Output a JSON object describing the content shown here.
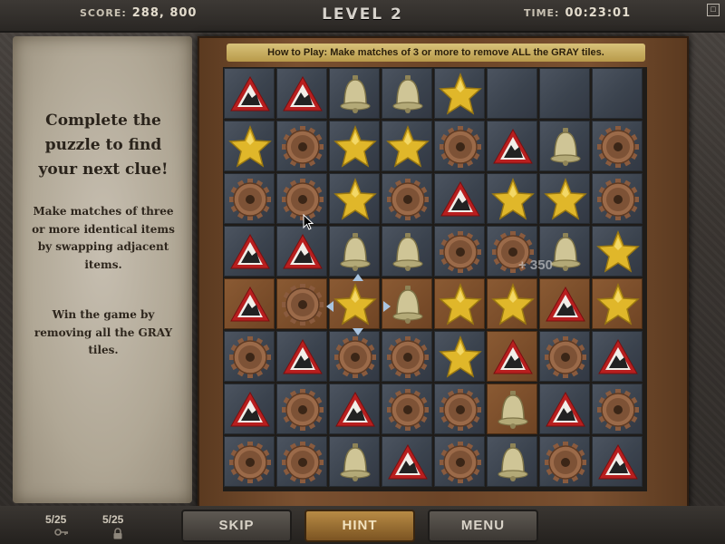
{
  "header": {
    "score_label": "SCORE:",
    "score_value": "288, 800",
    "level": "LEVEL 2",
    "time_label": "TIME:",
    "time_value": "00:23:01"
  },
  "instructions": {
    "title": "Complete the puzzle to find your next clue!",
    "text1": "Make matches of three or more identical items by swapping adjacent items.",
    "text2": "Win the game by removing all the GRAY tiles."
  },
  "howto": "How to Play: Make matches of 3 or more to remove ALL the GRAY tiles.",
  "score_popup": "+ 350",
  "board": {
    "rows": [
      [
        "warning",
        "warning",
        "bell",
        "bell",
        "star",
        "empty",
        "empty",
        "empty"
      ],
      [
        "star",
        "gear",
        "star",
        "star",
        "gear",
        "warning",
        "bell",
        "gear"
      ],
      [
        "gear",
        "gear",
        "star",
        "gear",
        "warning",
        "star",
        "star",
        "gear"
      ],
      [
        "warning",
        "warning",
        "bell",
        "bell",
        "gear",
        "gear",
        "bell",
        "star"
      ],
      [
        "warning",
        "gear",
        "star",
        "bell",
        "star",
        "star",
        "warning",
        "star"
      ],
      [
        "gear",
        "warning",
        "gear",
        "gear",
        "star",
        "warning",
        "gear",
        "warning"
      ],
      [
        "warning",
        "gear",
        "warning",
        "gear",
        "gear",
        "bell",
        "warning",
        "gear"
      ],
      [
        "gear",
        "gear",
        "bell",
        "warning",
        "gear",
        "bell",
        "gear",
        "warning"
      ]
    ],
    "tile_state": [
      [
        "gray",
        "gray",
        "gray",
        "gray",
        "gray",
        "gray",
        "gray",
        "gray"
      ],
      [
        "gray",
        "gray",
        "gray",
        "gray",
        "gray",
        "gray",
        "gray",
        "gray"
      ],
      [
        "gray",
        "gray",
        "gray",
        "gray",
        "gray",
        "gray",
        "gray",
        "gray"
      ],
      [
        "gray",
        "gray",
        "gray",
        "gray",
        "gray",
        "gray",
        "gray",
        "gray"
      ],
      [
        "cleared",
        "cleared",
        "cleared",
        "cleared",
        "cleared",
        "cleared",
        "cleared",
        "cleared"
      ],
      [
        "gray",
        "gray",
        "gray",
        "gray",
        "gray",
        "cleared",
        "gray",
        "gray"
      ],
      [
        "gray",
        "gray",
        "gray",
        "gray",
        "gray",
        "cleared",
        "gray",
        "gray"
      ],
      [
        "gray",
        "gray",
        "gray",
        "gray",
        "gray",
        "gray",
        "gray",
        "gray"
      ]
    ],
    "selected": {
      "row": 4,
      "col": 2
    }
  },
  "footer": {
    "keys_count": "5/25",
    "locks_count": "5/25",
    "skip_label": "SKIP",
    "hint_label": "HINT",
    "menu_label": "MENU"
  },
  "colors": {
    "gray_tile": "#3b434e",
    "cleared_tile": "#7a4d2a",
    "wood_frame": "#6b4427",
    "parchment": "#b0a795",
    "hint_button": "#9a6e33"
  },
  "icons": {
    "warning": "warning-sign-icon",
    "bell": "bell-icon",
    "star": "star-icon",
    "gear": "gear-icon"
  }
}
